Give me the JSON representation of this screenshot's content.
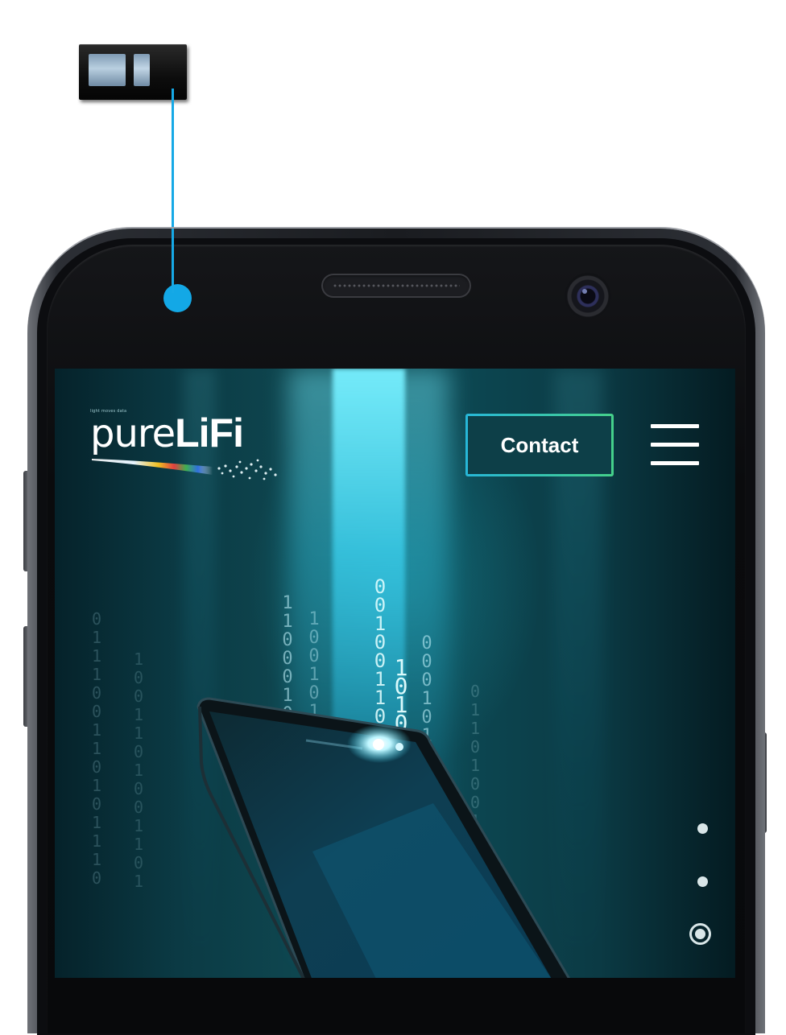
{
  "site": {
    "logo_tagline": "light moves data",
    "logo_light": "pure",
    "logo_bold": "LiFi",
    "contact_label": "Contact"
  },
  "colors": {
    "callout": "#13a8e6",
    "contact_border_start": "#27b7d8",
    "contact_border_end": "#45d08a",
    "hero_teal": "#0d4a55"
  },
  "icons": {
    "menu": "hamburger-menu-icon",
    "sensor": "photodetector-chip-icon"
  },
  "binary_columns": [
    "0\n1\n1\n1\n0\n0\n1\n1\n0\n1\n0\n1\n1\n1\n0",
    "1\n0\n0\n1\n1\n0\n1\n0\n0\n1\n1\n0\n1",
    "1\n1\n0\n0\n0\n1\n0",
    "1\n0\n0\n1\n0\n1",
    "0\n0\n1\n0\n0\n1\n1\n0\n1",
    "1\n0\n1\n0\n0\n1",
    "0\n0\n0\n1\n0\n1\n0",
    "0\n1\n1\n0\n1\n0\n0\n1\n0"
  ],
  "slider": {
    "total_slides": 3,
    "active_slide": 3
  }
}
